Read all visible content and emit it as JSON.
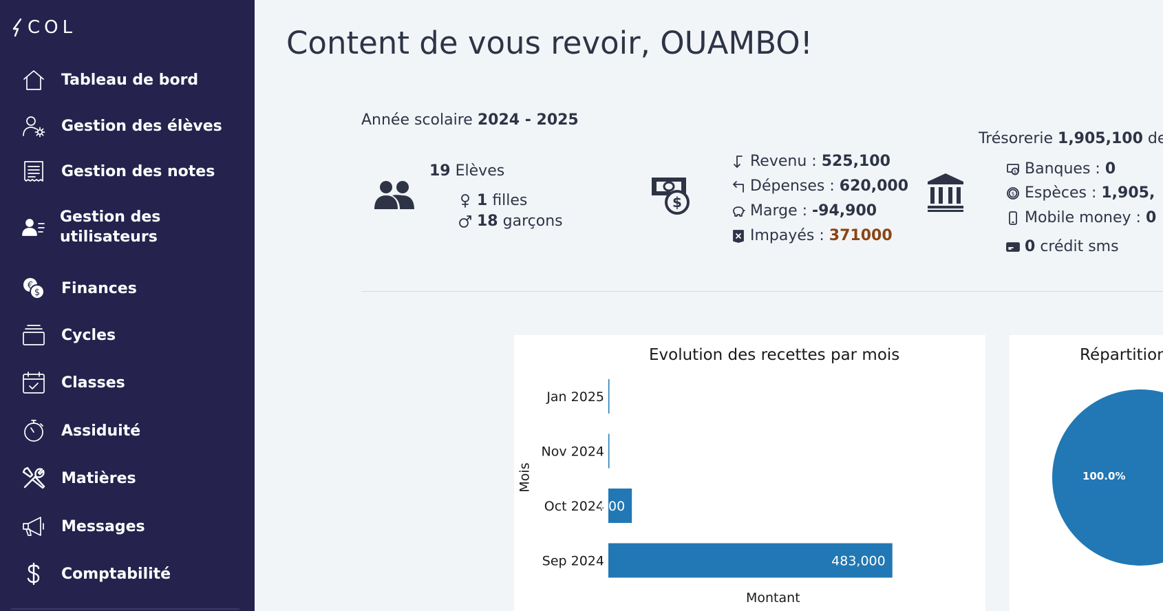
{
  "sidebar": {
    "logo": "COL",
    "items": [
      {
        "label": "Tableau de bord",
        "icon": "home-icon"
      },
      {
        "label": "Gestion des élèves",
        "icon": "user-gear-icon"
      },
      {
        "label": "Gestion des notes",
        "icon": "receipt-icon"
      },
      {
        "label": "Gestion des\nutilisateurs",
        "icon": "users-list-icon"
      },
      {
        "label": "Finances",
        "icon": "coins-icon"
      },
      {
        "label": "Cycles",
        "icon": "layers-icon"
      },
      {
        "label": "Classes",
        "icon": "calendar-check-icon"
      },
      {
        "label": "Assiduité",
        "icon": "stopwatch-icon"
      },
      {
        "label": "Matières",
        "icon": "tools-icon"
      },
      {
        "label": "Messages",
        "icon": "megaphone-icon"
      },
      {
        "label": "Comptabilité",
        "icon": "dollar-icon"
      }
    ]
  },
  "header": {
    "welcome": "Content de vous revoir, OUAMBO!"
  },
  "school_year": {
    "label": "Année scolaire",
    "value": "2024 - 2025"
  },
  "students": {
    "count": "19",
    "label": "Elèves",
    "girls_count": "1",
    "girls_label": "filles",
    "boys_count": "18",
    "boys_label": "garçons"
  },
  "finance": {
    "revenue_label": "Revenu :",
    "revenue_value": "525,100",
    "expenses_label": "Dépenses :",
    "expenses_value": "620,000",
    "margin_label": "Marge :",
    "margin_value": "-94,900",
    "unpaid_label": "Impayés :",
    "unpaid_value": "371000"
  },
  "treasury": {
    "label": "Trésorerie",
    "value": "1,905,100",
    "suffix": "de",
    "banks_label": "Banques :",
    "banks_value": "0",
    "cash_label": "Espèces :",
    "cash_value": "1,905,",
    "mobile_label": "Mobile money :",
    "mobile_value": "0",
    "sms_count": "0",
    "sms_label": "crédit sms"
  },
  "pie_chart": {
    "title": "Répartition",
    "slice_label": "100.0%"
  },
  "colors": {
    "sidebar_bg": "#25234d",
    "bar": "#2178b4",
    "unpaid": "#8b4513",
    "page_bg": "#f2f5f8"
  },
  "chart_data": [
    {
      "type": "bar",
      "orientation": "horizontal",
      "title": "Evolution des recettes par mois",
      "xlabel": "Montant",
      "ylabel": "Mois",
      "categories": [
        "Jan 2025",
        "Nov 2024",
        "Oct 2024",
        "Sep 2024"
      ],
      "values": [
        500,
        600,
        40000,
        483000
      ],
      "data_labels": [
        "",
        "",
        "000",
        "483,000"
      ],
      "xlim": [
        0,
        550000
      ],
      "grid": false
    },
    {
      "type": "pie",
      "title": "Répartition",
      "values": [
        100.0
      ],
      "labels": [
        "100.0%"
      ]
    }
  ]
}
